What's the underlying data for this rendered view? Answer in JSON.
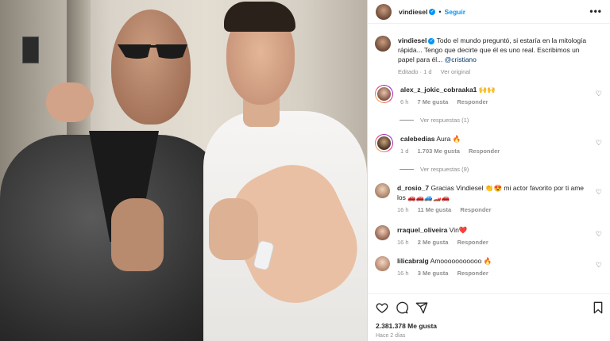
{
  "post": {
    "username": "vindiesel",
    "follow_label": "Seguir",
    "dot": "•",
    "more_label": "•••",
    "verified_glyph": "✓"
  },
  "caption": {
    "username": "vindiesel",
    "text": " Todo el mundo preguntó, si estaría en la mitología rápida... Tengo que decirte que él es uno real. Escribimos un papel para él... ",
    "mention": "@cristiano",
    "edited": "Editado · 1 d",
    "see_original": "Ver original"
  },
  "comments": [
    {
      "username": "alex_z_jokic_cobraaka1",
      "text": " 🙌🙌",
      "age": "6 h",
      "likes": "7 Me gusta",
      "reply": "Responder",
      "view_replies": "Ver respuestas (1)"
    },
    {
      "username": "calebedias",
      "text": " Aura 🔥",
      "age": "1 d",
      "likes": "1.703 Me gusta",
      "reply": "Responder",
      "view_replies": "Ver respuestas (9)"
    },
    {
      "username": "d_rosio_7",
      "text": " Gracias Vindiesel 👏😍 mi actor favorito por ti ame los 🚗🚗🚙🏎️🚗",
      "age": "16 h",
      "likes": "11 Me gusta",
      "reply": "Responder"
    },
    {
      "username": "rraquel_oliveira",
      "text": " Vin❤️",
      "age": "16 h",
      "likes": "2 Me gusta",
      "reply": "Responder"
    },
    {
      "username": "lilicabralg",
      "text": " Amooooooooooo 🔥",
      "age": "16 h",
      "likes": "3 Me gusta",
      "reply": "Responder"
    }
  ],
  "footer": {
    "likes": "2.381.378 Me gusta",
    "time": "Hace 2 días"
  },
  "icons": {
    "like": "heart-icon",
    "comment": "comment-icon",
    "share": "share-icon",
    "save": "bookmark-icon"
  },
  "colors": {
    "accent": "#0095f6",
    "muted": "#8e8e8e",
    "text": "#262626",
    "like_red": "#ed4956"
  }
}
